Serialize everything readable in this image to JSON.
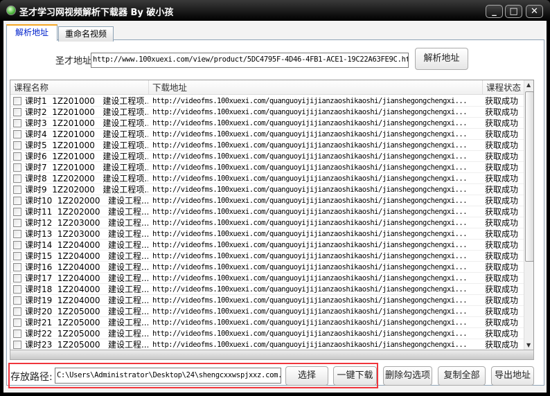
{
  "window": {
    "title": "圣才学习网视频解析下载器 By 破小孩",
    "minimize": "_",
    "maximize": "□",
    "close": "✕"
  },
  "tabs": [
    {
      "label": "解析地址"
    },
    {
      "label": "重命名视频"
    }
  ],
  "parse": {
    "label": "圣才地址",
    "url": "http://www.100xuexi.com/view/product/5DC4795F-4D46-4FB1-ACE1-19C22A63FE9C.html",
    "button": "解析地址"
  },
  "list": {
    "headers": [
      "课程名称",
      "下载地址",
      "课程状态"
    ],
    "rows": [
      {
        "name": "课时1  1Z201000   建设工程项...",
        "url": "http://videofms.100xuexi.com/quanguoyijijianzaoshikaoshi/jianshegongchengxi...",
        "status": "获取成功"
      },
      {
        "name": "课时2  1Z201000   建设工程项...",
        "url": "http://videofms.100xuexi.com/quanguoyijijianzaoshikaoshi/jianshegongchengxi...",
        "status": "获取成功"
      },
      {
        "name": "课时3  1Z201000   建设工程项...",
        "url": "http://videofms.100xuexi.com/quanguoyijijianzaoshikaoshi/jianshegongchengxi...",
        "status": "获取成功"
      },
      {
        "name": "课时4  1Z201000   建设工程项...",
        "url": "http://videofms.100xuexi.com/quanguoyijijianzaoshikaoshi/jianshegongchengxi...",
        "status": "获取成功"
      },
      {
        "name": "课时5  1Z201000   建设工程项...",
        "url": "http://videofms.100xuexi.com/quanguoyijijianzaoshikaoshi/jianshegongchengxi...",
        "status": "获取成功"
      },
      {
        "name": "课时6  1Z201000   建设工程项...",
        "url": "http://videofms.100xuexi.com/quanguoyijijianzaoshikaoshi/jianshegongchengxi...",
        "status": "获取成功"
      },
      {
        "name": "课时7  1Z201000   建设工程项...",
        "url": "http://videofms.100xuexi.com/quanguoyijijianzaoshikaoshi/jianshegongchengxi...",
        "status": "获取成功"
      },
      {
        "name": "课时8  1Z202000   建设工程项...",
        "url": "http://videofms.100xuexi.com/quanguoyijijianzaoshikaoshi/jianshegongchengxi...",
        "status": "获取成功"
      },
      {
        "name": "课时9  1Z202000   建设工程项...",
        "url": "http://videofms.100xuexi.com/quanguoyijijianzaoshikaoshi/jianshegongchengxi...",
        "status": "获取成功"
      },
      {
        "name": "课时10  1Z202000   建设工程...",
        "url": "http://videofms.100xuexi.com/quanguoyijijianzaoshikaoshi/jianshegongchengxi...",
        "status": "获取成功"
      },
      {
        "name": "课时11  1Z202000   建设工程...",
        "url": "http://videofms.100xuexi.com/quanguoyijijianzaoshikaoshi/jianshegongchengxi...",
        "status": "获取成功"
      },
      {
        "name": "课时12  1Z203000   建设工程...",
        "url": "http://videofms.100xuexi.com/quanguoyijijianzaoshikaoshi/jianshegongchengxi...",
        "status": "获取成功"
      },
      {
        "name": "课时13  1Z203000   建设工程...",
        "url": "http://videofms.100xuexi.com/quanguoyijijianzaoshikaoshi/jianshegongchengxi...",
        "status": "获取成功"
      },
      {
        "name": "课时14  1Z204000   建设工程...",
        "url": "http://videofms.100xuexi.com/quanguoyijijianzaoshikaoshi/jianshegongchengxi...",
        "status": "获取成功"
      },
      {
        "name": "课时15  1Z204000   建设工程...",
        "url": "http://videofms.100xuexi.com/quanguoyijijianzaoshikaoshi/jianshegongchengxi...",
        "status": "获取成功"
      },
      {
        "name": "课时16  1Z204000   建设工程...",
        "url": "http://videofms.100xuexi.com/quanguoyijijianzaoshikaoshi/jianshegongchengxi...",
        "status": "获取成功"
      },
      {
        "name": "课时17  1Z204000   建设工程...",
        "url": "http://videofms.100xuexi.com/quanguoyijijianzaoshikaoshi/jianshegongchengxi...",
        "status": "获取成功"
      },
      {
        "name": "课时18  1Z204000   建设工程...",
        "url": "http://videofms.100xuexi.com/quanguoyijijianzaoshikaoshi/jianshegongchengxi...",
        "status": "获取成功"
      },
      {
        "name": "课时19  1Z204000   建设工程...",
        "url": "http://videofms.100xuexi.com/quanguoyijijianzaoshikaoshi/jianshegongchengxi...",
        "status": "获取成功"
      },
      {
        "name": "课时20  1Z205000   建设工程...",
        "url": "http://videofms.100xuexi.com/quanguoyijijianzaoshikaoshi/jianshegongchengxi...",
        "status": "获取成功"
      },
      {
        "name": "课时21  1Z205000   建设工程...",
        "url": "http://videofms.100xuexi.com/quanguoyijijianzaoshikaoshi/jianshegongchengxi...",
        "status": "获取成功"
      },
      {
        "name": "课时22  1Z205000   建设工程...",
        "url": "http://videofms.100xuexi.com/quanguoyijijianzaoshikaoshi/jianshegongchengxi...",
        "status": "获取成功"
      },
      {
        "name": "课时23  1Z205000   建设工程...",
        "url": "http://videofms.100xuexi.com/quanguoyijijianzaoshikaoshi/jianshegongchengxi...",
        "status": "获取成功"
      }
    ]
  },
  "bottom": {
    "path_label": "存放路径:",
    "path": "C:\\Users\\Administrator\\Desktop\\24\\shengcxxwspjxxz.com.",
    "choose": "选择",
    "download_all": "一键下载",
    "delete_checked": "删除勾选项",
    "copy_all": "复制全部",
    "export": "导出地址"
  },
  "colors": {
    "highlight": "#f0353c",
    "active_tab": "#0022cc"
  }
}
